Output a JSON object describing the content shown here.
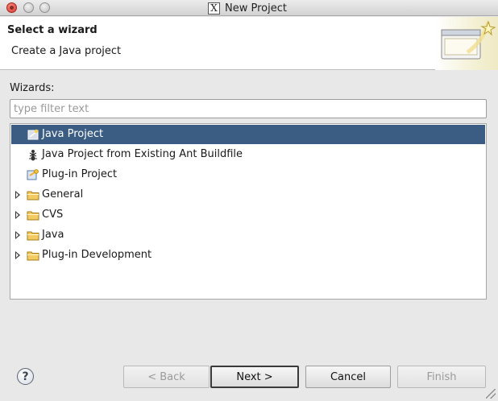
{
  "window": {
    "title": "New Project"
  },
  "banner": {
    "title": "Select a wizard",
    "subtitle": "Create a Java project"
  },
  "wizards": {
    "label": "Wizards:",
    "filter_placeholder": "type filter text",
    "filter_value": "",
    "items": [
      {
        "label": "Java Project",
        "icon": "java-project-icon",
        "selected": true,
        "expandable": false
      },
      {
        "label": "Java Project from Existing Ant Buildfile",
        "icon": "ant-icon",
        "selected": false,
        "expandable": false
      },
      {
        "label": "Plug-in Project",
        "icon": "plugin-project-icon",
        "selected": false,
        "expandable": false
      },
      {
        "label": "General",
        "icon": "folder-icon",
        "selected": false,
        "expandable": true
      },
      {
        "label": "CVS",
        "icon": "folder-icon",
        "selected": false,
        "expandable": true
      },
      {
        "label": "Java",
        "icon": "folder-icon",
        "selected": false,
        "expandable": true
      },
      {
        "label": "Plug-in Development",
        "icon": "folder-icon",
        "selected": false,
        "expandable": true
      }
    ]
  },
  "buttons": {
    "help": "?",
    "back": "< Back",
    "next": "Next >",
    "cancel": "Cancel",
    "finish": "Finish"
  },
  "colors": {
    "selection": "#3b5d84",
    "folder": "#e8b93c"
  }
}
